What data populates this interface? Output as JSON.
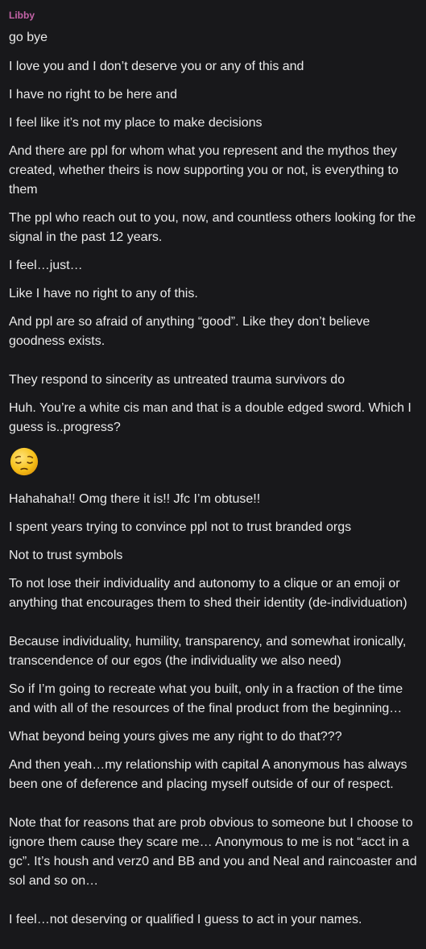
{
  "sender": {
    "name": "Libby",
    "color": "#c463a8"
  },
  "messages": [
    "go bye",
    "I love you and I don’t deserve you or any of this and",
    "I have no right to be here and",
    "I feel like it’s not my place to make decisions",
    "And there are ppl for whom what you represent and the mythos they created, whether theirs is now supporting you or not, is everything to them",
    "The ppl who reach out to you, now, and countless others looking for the signal in the past 12 years.",
    "I feel…just…",
    "Like I have no right to any of this.",
    "And ppl are so afraid of anything “good”. Like they don’t believe goodness exists.",
    "They respond to sincerity as untreated trauma survivors do",
    "Huh. You’re a white cis man and that is a double edged sword. Which I guess is..progress?",
    "Hahahaha!! Omg there it is!! Jfc I’m obtuse!!",
    "I spent years trying to convince ppl not to trust branded orgs",
    "Not to trust symbols",
    "To not lose their individuality and autonomy to a clique or an emoji or anything that encourages them to shed their identity (de-individuation)",
    "Because individuality, humility, transparency, and somewhat ironically, transcendence of our egos (the individuality we also need)",
    "So if I’m going to recreate what you built, only in a fraction of the time and with all of the resources of the final product from the beginning…",
    "What beyond being yours gives me any right to do that???",
    "And then yeah…my relationship with capital A anonymous has always been one of deference and placing myself outside of our of respect.",
    "Note that for reasons that are prob obvious to someone but I choose to ignore them cause they scare me… Anonymous to me is not “acct in a gc”. It’s housh and verz0 and BB and you and Neal and raincoaster and sol and so on…",
    "I feel…not deserving or qualified I guess to act in your names."
  ],
  "emoji": {
    "name": "pensive-face-emoji",
    "color": "#f7c21b"
  }
}
